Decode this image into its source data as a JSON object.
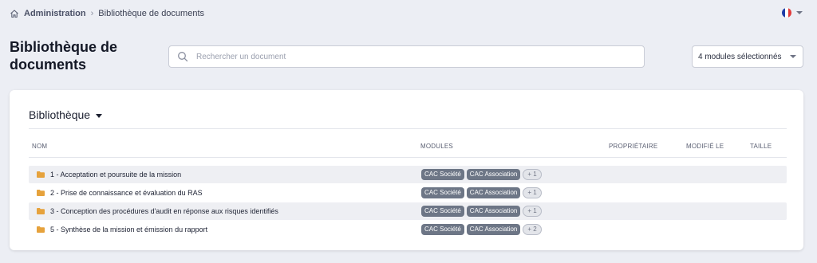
{
  "breadcrumb": {
    "items": [
      "Administration",
      "Bibliothèque de documents"
    ],
    "separator": "›"
  },
  "language": {
    "flag": "france-flag-icon",
    "colors": [
      "#1f3ea8",
      "#ffffff",
      "#e23b3b"
    ]
  },
  "page": {
    "title": "Bibliothèque de documents"
  },
  "search": {
    "placeholder": "Rechercher un document",
    "value": ""
  },
  "module_filter": {
    "selected": "4 modules sélectionnés"
  },
  "library": {
    "title": "Bibliothèque",
    "columns": [
      "NOM",
      "MODULES",
      "PROPRIÉTAIRE",
      "MODIFIÉ LE",
      "TAILLE"
    ],
    "rows": [
      {
        "name": "1 - Acceptation et poursuite de la mission",
        "modules": [
          "CAC Société",
          "CAC Association"
        ],
        "more": "+ 1",
        "owner": "",
        "modified": "",
        "size": ""
      },
      {
        "name": "2 - Prise de connaissance et évaluation du RAS",
        "modules": [
          "CAC Société",
          "CAC Association"
        ],
        "more": "+ 1",
        "owner": "",
        "modified": "",
        "size": ""
      },
      {
        "name": "3 - Conception des procédures d'audit en réponse aux risques identifiés",
        "modules": [
          "CAC Société",
          "CAC Association"
        ],
        "more": "+ 1",
        "owner": "",
        "modified": "",
        "size": ""
      },
      {
        "name": "5 - Synthèse de la mission et émission du rapport",
        "modules": [
          "CAC Société",
          "CAC Association"
        ],
        "more": "+ 2",
        "owner": "",
        "modified": "",
        "size": ""
      }
    ]
  },
  "colors": {
    "background": "#eceef4",
    "folder": "#e6a23c",
    "badge": "#6d7686"
  }
}
